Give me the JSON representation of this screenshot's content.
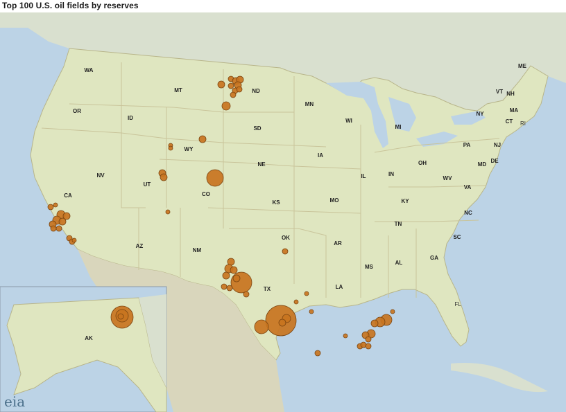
{
  "title": "Top 100 U.S. oil fields by reserves",
  "logo_text": "eia",
  "colors": {
    "water": "#bcd3e6",
    "land_foreign": "#d9e0cf",
    "land_us": "#dfe6c0",
    "border": "#b8b58a",
    "field_fill": "#c8741f",
    "field_stroke": "#7a4511"
  },
  "state_labels": [
    "WA",
    "MT",
    "ND",
    "MN",
    "ME",
    "OR",
    "ID",
    "SD",
    "WI",
    "MI",
    "NY",
    "VT",
    "NH",
    "MA",
    "CT",
    "RI",
    "WY",
    "PA",
    "NJ",
    "NE",
    "IA",
    "OH",
    "MD",
    "DE",
    "NV",
    "UT",
    "CO",
    "IL",
    "IN",
    "WV",
    "VA",
    "CA",
    "KS",
    "MO",
    "KY",
    "NC",
    "TN",
    "OK",
    "AZ",
    "NM",
    "AR",
    "SC",
    "MS",
    "AL",
    "GA",
    "TX",
    "LA",
    "FL",
    "AK"
  ],
  "fields": [
    {
      "state": "ND",
      "size": "small"
    },
    {
      "state": "CO",
      "size": "medium"
    },
    {
      "state": "WY",
      "size": "small"
    },
    {
      "state": "UT",
      "size": "small"
    },
    {
      "state": "CA",
      "size": "small"
    },
    {
      "state": "TX",
      "size": "large"
    },
    {
      "state": "NM",
      "size": "small"
    },
    {
      "state": "OK",
      "size": "small"
    },
    {
      "state": "LA",
      "size": "small"
    },
    {
      "state": "AK",
      "size": "large"
    }
  ]
}
